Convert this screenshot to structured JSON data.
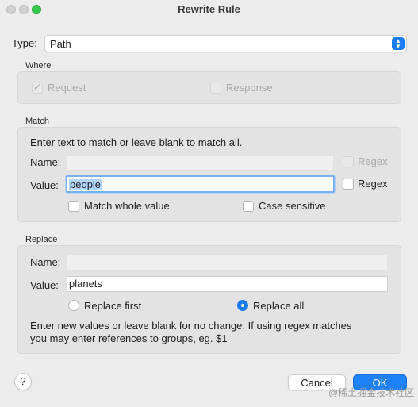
{
  "window": {
    "title": "Rewrite Rule"
  },
  "type": {
    "label": "Type:",
    "value": "Path"
  },
  "where": {
    "title": "Where",
    "request_label": "Request",
    "response_label": "Response"
  },
  "match": {
    "title": "Match",
    "instruction": "Enter text to match or leave blank to match all.",
    "name_label": "Name:",
    "name_value": "",
    "name_regex_label": "Regex",
    "value_label": "Value:",
    "value_value": "people",
    "value_regex_label": "Regex",
    "match_whole_label": "Match whole value",
    "case_sensitive_label": "Case sensitive"
  },
  "replace": {
    "title": "Replace",
    "name_label": "Name:",
    "name_value": "",
    "value_label": "Value:",
    "value_value": "planets",
    "replace_first_label": "Replace first",
    "replace_all_label": "Replace all",
    "note_line1": "Enter new values or leave blank for no change. If using regex matches",
    "note_line2": "you may enter references to groups, eg. $1"
  },
  "footer": {
    "help_label": "?",
    "cancel_label": "Cancel",
    "ok_label": "OK",
    "watermark": "@稀土掘金技术社区"
  },
  "colors": {
    "accent": "#1f81f6",
    "traffic_green": "#32c748"
  }
}
